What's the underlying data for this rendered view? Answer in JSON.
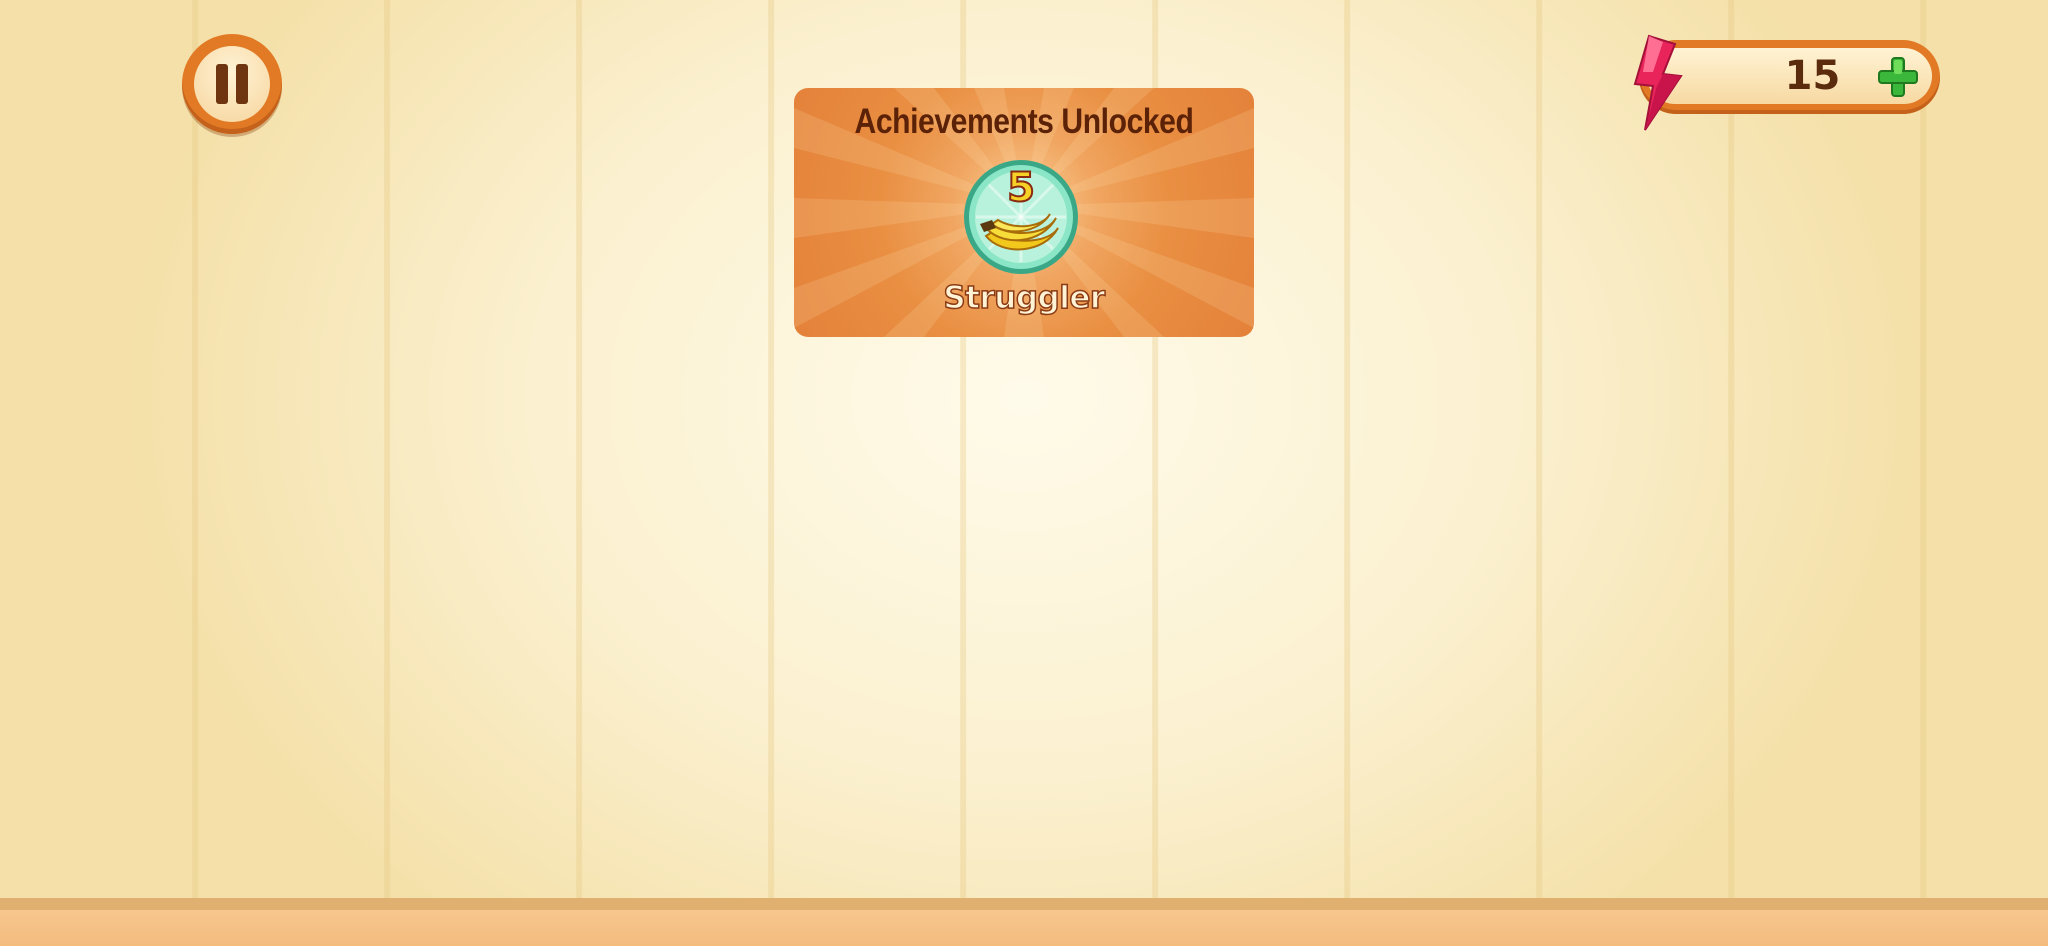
{
  "hud": {
    "pause_icon": "pause-icon",
    "energy": {
      "value": "15",
      "icon": "lightning-bolt-icon",
      "add_icon": "plus-icon"
    }
  },
  "achievement": {
    "title": "Achievements Unlocked",
    "badge_number": "5",
    "badge_icon": "banana-icon",
    "name": "Struggler"
  },
  "colors": {
    "accent_orange": "#e27a25",
    "card_orange": "#e98f42",
    "title_brown": "#5b2208",
    "badge_teal": "#6fd8b5",
    "bolt_pink": "#e8245a",
    "plus_green": "#3bb83b"
  }
}
